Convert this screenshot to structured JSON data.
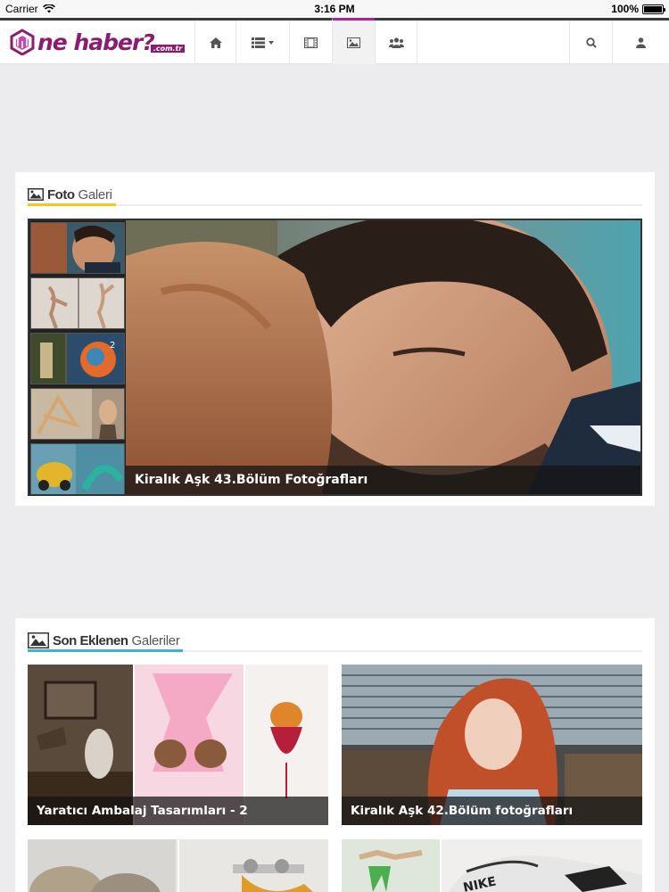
{
  "status_bar": {
    "carrier": "Carrier",
    "time": "3:16 PM",
    "battery": "100%",
    "battery_level": 1.0
  },
  "header": {
    "logo": {
      "name": "ne haber?",
      "suffix": ".com.tr"
    },
    "nav": [
      {
        "icon": "home-icon"
      },
      {
        "icon": "list-icon"
      },
      {
        "icon": "film-icon"
      },
      {
        "icon": "picture-icon",
        "active": true
      },
      {
        "icon": "users-icon"
      },
      {
        "icon": "search-icon"
      },
      {
        "icon": "user-icon"
      }
    ]
  },
  "photo_gallery": {
    "title_bold": "Foto",
    "title_light": "Galeri",
    "accent": "#f2c81a",
    "featured_caption": "Kiralık Aşk 43.Bölüm Fotoğrafları"
  },
  "recent_galleries": {
    "title_bold": "Son Eklenen",
    "title_light": "Galeriler",
    "accent": "#3ab3d6",
    "items": [
      {
        "caption": "Yaratıcı Ambalaj Tasarımları - 2"
      },
      {
        "caption": "Kiralık Aşk 42.Bölüm fotoğrafları"
      },
      {
        "caption": ""
      },
      {
        "caption": ""
      }
    ]
  },
  "colors": {
    "brand": "#8a1d71",
    "active_nav": "#a6289b"
  }
}
